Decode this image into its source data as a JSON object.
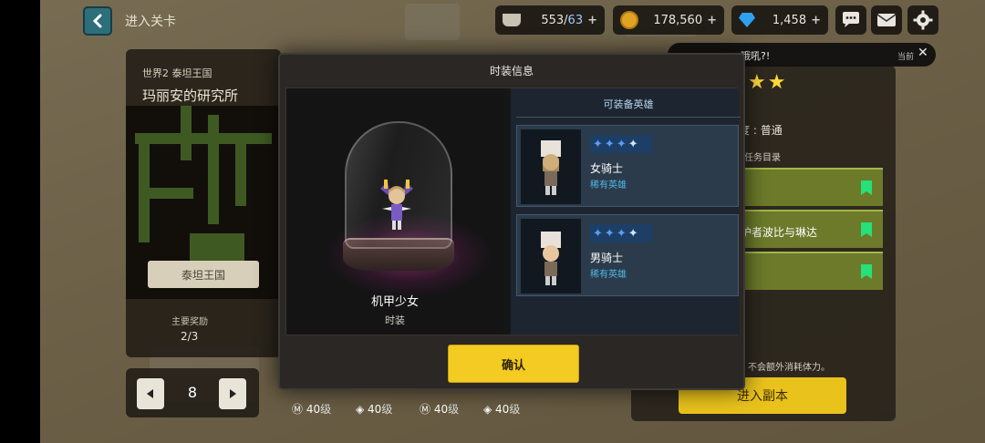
{
  "topbar": {
    "title": "进入关卡",
    "stamina": {
      "value": "553/",
      "max": "63"
    },
    "gold": "178,560",
    "gems": "1,458"
  },
  "stage": {
    "world": "世界2  泰坦王国",
    "name": "玛丽安的研究所",
    "region_tab": "泰坦王国",
    "reward_label": "主要奖励",
    "reward_count": "2/3",
    "stage_number": "8"
  },
  "party": [
    {
      "level": "40",
      "unit": "级"
    },
    {
      "level": "40",
      "unit": "级"
    },
    {
      "level": "40",
      "unit": "级"
    },
    {
      "level": "40",
      "unit": "级"
    }
  ],
  "right_panel": {
    "banner_text": "哦吼?!",
    "banner_current": "当前",
    "difficulty_label": "度",
    "difficulty_value": "普通",
    "mission_label": "任务目录",
    "mission_item_2": "护者波比与琳达",
    "note": "不会额外消耗体力。",
    "enter_button": "进入副本"
  },
  "modal": {
    "title": "时装信息",
    "costume_name": "机甲少女",
    "costume_type": "时装",
    "heroes_header": "可装备英雄",
    "heroes": [
      {
        "name": "女骑士",
        "rarity": "稀有英雄",
        "stars": 4
      },
      {
        "name": "男骑士",
        "rarity": "稀有英雄",
        "stars": 4
      }
    ],
    "confirm": "确认"
  }
}
